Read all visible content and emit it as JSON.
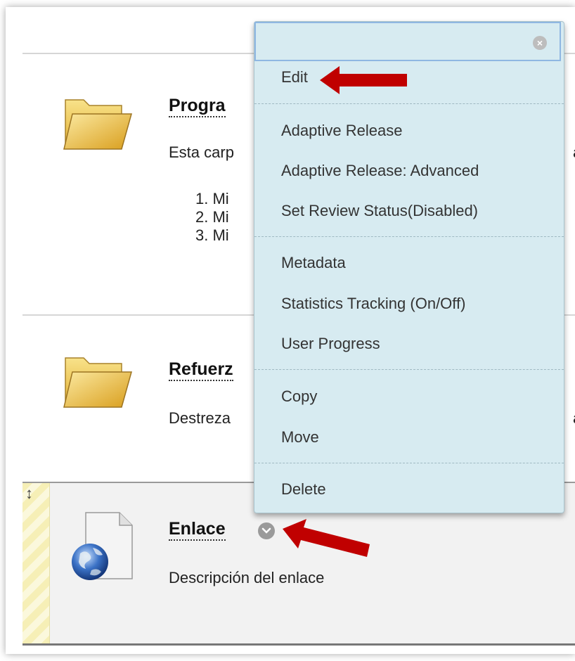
{
  "items": [
    {
      "type": "folder",
      "title": "Progra",
      "description": "Esta carp",
      "description_overflow": "a",
      "sublist": [
        "1. Mi",
        "2. Mi",
        "3. Mi"
      ]
    },
    {
      "type": "folder",
      "title": "Refuerz",
      "description": "Destreza",
      "description_overflow": "a"
    },
    {
      "type": "link",
      "title": "Enlace",
      "description": "Descripción del enlace",
      "drag_handle_glyph": "↕"
    }
  ],
  "context_menu": {
    "search_value": "",
    "clear_glyph": "×",
    "groups": [
      [
        "Edit"
      ],
      [
        "Adaptive Release",
        "Adaptive Release: Advanced",
        "Set Review Status(Disabled)"
      ],
      [
        "Metadata",
        "Statistics Tracking (On/Off)",
        "User Progress"
      ],
      [
        "Copy",
        "Move"
      ],
      [
        "Delete"
      ]
    ]
  },
  "colors": {
    "menu_bg": "#d7ebf1",
    "arrow": "#c00000",
    "drag_strip": "#f6efb6"
  },
  "icons": {
    "folder": "folder-icon",
    "link": "web-link-icon",
    "chevron": "chevron-down-icon",
    "clear": "clear-icon",
    "drag": "drag-handle-icon"
  }
}
